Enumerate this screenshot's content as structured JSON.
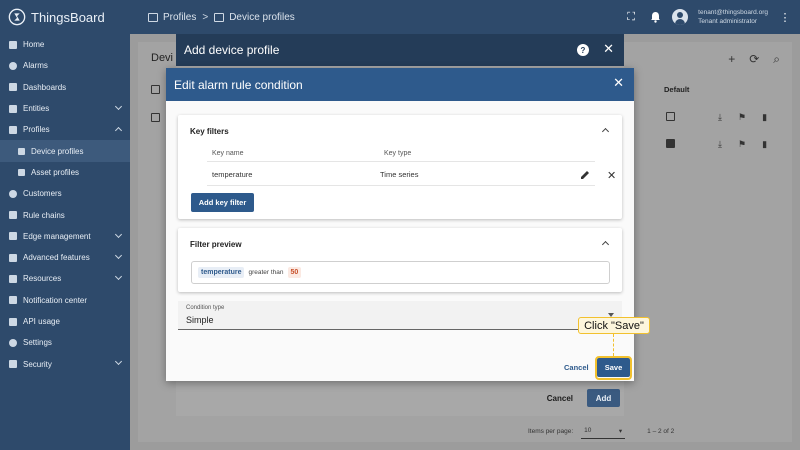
{
  "app": {
    "logo_text": "ThingsBoard"
  },
  "header": {
    "breadcrumbs": [
      {
        "label": "Profiles"
      },
      {
        "label": "Device profiles"
      }
    ],
    "breadcrumb_separator": ">",
    "user_email": "tenant@thingsboard.org",
    "user_role": "Tenant administrator",
    "icons": [
      "fullscreen-icon",
      "bell-icon",
      "account-icon",
      "more-vert-icon"
    ]
  },
  "sidebar": {
    "items": [
      {
        "label": "Home",
        "icon": "home-icon"
      },
      {
        "label": "Alarms",
        "icon": "alarm-icon"
      },
      {
        "label": "Dashboards",
        "icon": "dashboard-icon"
      },
      {
        "label": "Entities",
        "icon": "entities-icon",
        "expand": "down"
      },
      {
        "label": "Profiles",
        "icon": "profiles-icon",
        "expand": "up"
      },
      {
        "label": "Device profiles",
        "icon": "device-profile-icon",
        "sub": true,
        "active": true
      },
      {
        "label": "Asset profiles",
        "icon": "asset-profile-icon",
        "sub": true
      },
      {
        "label": "Customers",
        "icon": "customers-icon"
      },
      {
        "label": "Rule chains",
        "icon": "rule-chains-icon"
      },
      {
        "label": "Edge management",
        "icon": "edge-icon",
        "expand": "down"
      },
      {
        "label": "Advanced features",
        "icon": "advanced-icon",
        "expand": "down"
      },
      {
        "label": "Resources",
        "icon": "resources-icon",
        "expand": "down"
      },
      {
        "label": "Notification center",
        "icon": "notification-icon"
      },
      {
        "label": "API usage",
        "icon": "api-usage-icon"
      },
      {
        "label": "Settings",
        "icon": "settings-icon"
      },
      {
        "label": "Security",
        "icon": "security-icon",
        "expand": "down"
      }
    ]
  },
  "background_page": {
    "title": "Devi",
    "default_col": "Default",
    "items_per_page_label": "Items per page:",
    "items_per_page_value": "10",
    "range_text": "1 – 2 of 2"
  },
  "outer_dialog": {
    "title": "Add device profile",
    "cancel_label": "Cancel",
    "add_label": "Add"
  },
  "inner_dialog": {
    "title": "Edit alarm rule condition",
    "key_filters": {
      "title": "Key filters",
      "col_key_name": "Key name",
      "col_key_type": "Key type",
      "rows": [
        {
          "key_name": "temperature",
          "key_type": "Time series"
        }
      ],
      "add_button": "Add key filter"
    },
    "filter_preview": {
      "title": "Filter preview",
      "key": "temperature",
      "operator": "greater than",
      "value": "50"
    },
    "condition_type": {
      "label": "Condition type",
      "value": "Simple"
    },
    "cancel_label": "Cancel",
    "save_label": "Save"
  },
  "tutorial": {
    "callout_text": "Click \"Save\"",
    "highlight_color": "#f2c12e"
  }
}
